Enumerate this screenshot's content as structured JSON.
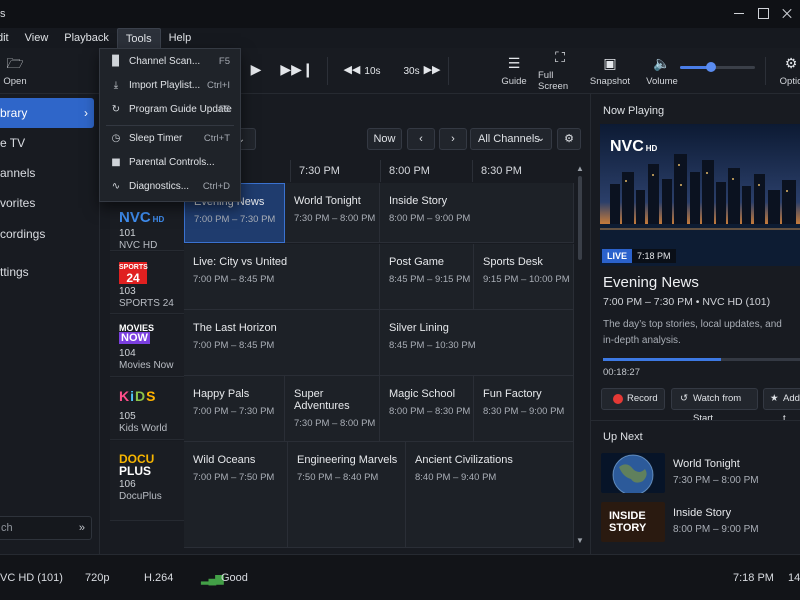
{
  "window": {
    "title": "s"
  },
  "menu": {
    "items": [
      "dit",
      "View",
      "Playback",
      "Tools",
      "Help"
    ]
  },
  "tools_menu": {
    "items": [
      {
        "icon": "signal-icon",
        "label": "Channel Scan...",
        "shortcut": "F5"
      },
      {
        "icon": "download-icon",
        "label": "Import Playlist...",
        "shortcut": "Ctrl+I"
      },
      {
        "icon": "refresh-icon",
        "label": "Program Guide Update",
        "shortcut": "F5"
      },
      {
        "icon": "clock-icon",
        "label": "Sleep Timer",
        "shortcut": "Ctrl+T"
      },
      {
        "icon": "lock-icon",
        "label": "Parental Controls...",
        "shortcut": ""
      },
      {
        "icon": "pulse-icon",
        "label": "Diagnostics...",
        "shortcut": "Ctrl+D"
      }
    ]
  },
  "toolbar": {
    "open": "Open",
    "rewind": "10s",
    "forward": "30s",
    "guide": "Guide",
    "fullscreen": "Full Screen",
    "snapshot": "Snapshot",
    "volume": "Volume",
    "options": "Optio",
    "volume_level": 0.42
  },
  "sidebar": {
    "items": [
      "brary",
      "e TV",
      "annels",
      "vorites",
      "cordings",
      "ttings"
    ],
    "search_placeholder": "ch"
  },
  "guide": {
    "now_label": "Now",
    "channel_filter": "All Channels",
    "time_headers": [
      "7:30 PM",
      "8:00 PM",
      "8:30 PM"
    ],
    "channels": [
      {
        "number": "101",
        "name": "NVC HD",
        "logo": "NVC"
      },
      {
        "number": "103",
        "name": "SPORTS 24",
        "logo": "SPORTS 24"
      },
      {
        "number": "104",
        "name": "Movies Now",
        "logo": "MOVIES NOW"
      },
      {
        "number": "105",
        "name": "Kids World",
        "logo": "KIDS"
      },
      {
        "number": "106",
        "name": "DocuPlus",
        "logo": "DOCU PLUS"
      }
    ],
    "programs": [
      {
        "title": "Evening News",
        "time": "7:00 PM – 7:30 PM"
      },
      {
        "title": "World Tonight",
        "time": "7:30 PM – 8:00 PM"
      },
      {
        "title": "Inside Story",
        "time": "8:00 PM – 9:00 PM"
      },
      {
        "title": "Live: City vs United",
        "time": "7:00 PM – 8:45 PM"
      },
      {
        "title": "Post Game",
        "time": "8:45 PM – 9:15 PM"
      },
      {
        "title": "Sports Desk",
        "time": "9:15 PM – 10:00 PM"
      },
      {
        "title": "The Last Horizon",
        "time": "7:00 PM – 8:45 PM"
      },
      {
        "title": "Silver Lining",
        "time": "8:45 PM – 10:30 PM"
      },
      {
        "title": "Happy Pals",
        "time": "7:00 PM – 7:30 PM"
      },
      {
        "title": "Super Adventures",
        "time": "7:30 PM – 8:00 PM"
      },
      {
        "title": "Magic School",
        "time": "8:00 PM – 8:30 PM"
      },
      {
        "title": "Fun Factory",
        "time": "8:30 PM – 9:00 PM"
      },
      {
        "title": "Wild Oceans",
        "time": "7:00 PM – 7:50 PM"
      },
      {
        "title": "Engineering Marvels",
        "time": "7:50 PM – 8:40 PM"
      },
      {
        "title": "Ancient Civilizations",
        "time": "8:40 PM – 9:40 PM"
      }
    ]
  },
  "now_playing": {
    "section_title": "Now Playing",
    "channel_logo": "NVC",
    "channel_logo_suffix": "HD",
    "live": "LIVE",
    "live_time": "7:18 PM",
    "title": "Evening News",
    "meta": "7:00 PM – 7:30 PM  •  NVC HD (101)",
    "description": "The day’s top stories, local updates, and in-depth analysis.",
    "elapsed": "00:18:27",
    "progress": 0.6,
    "record": "Record",
    "watch_from_start": "Watch from Start",
    "add": "Add t"
  },
  "up_next": {
    "section_title": "Up Next",
    "items": [
      {
        "title": "World Tonight",
        "time": "7:30 PM – 8:00 PM",
        "thumb": ""
      },
      {
        "title": "Inside Story",
        "time": "8:00 PM – 9:00 PM",
        "thumb": "INSIDE STORY"
      }
    ]
  },
  "status": {
    "channel": "VC HD (101)",
    "resolution": "720p",
    "codec": "H.264",
    "signal": "Good",
    "time": "7:18 PM",
    "extra": "14"
  },
  "colors": {
    "accent": "#2f66c9",
    "live": "#2b62cc",
    "record": "#e53935",
    "signal": "#43a047"
  }
}
